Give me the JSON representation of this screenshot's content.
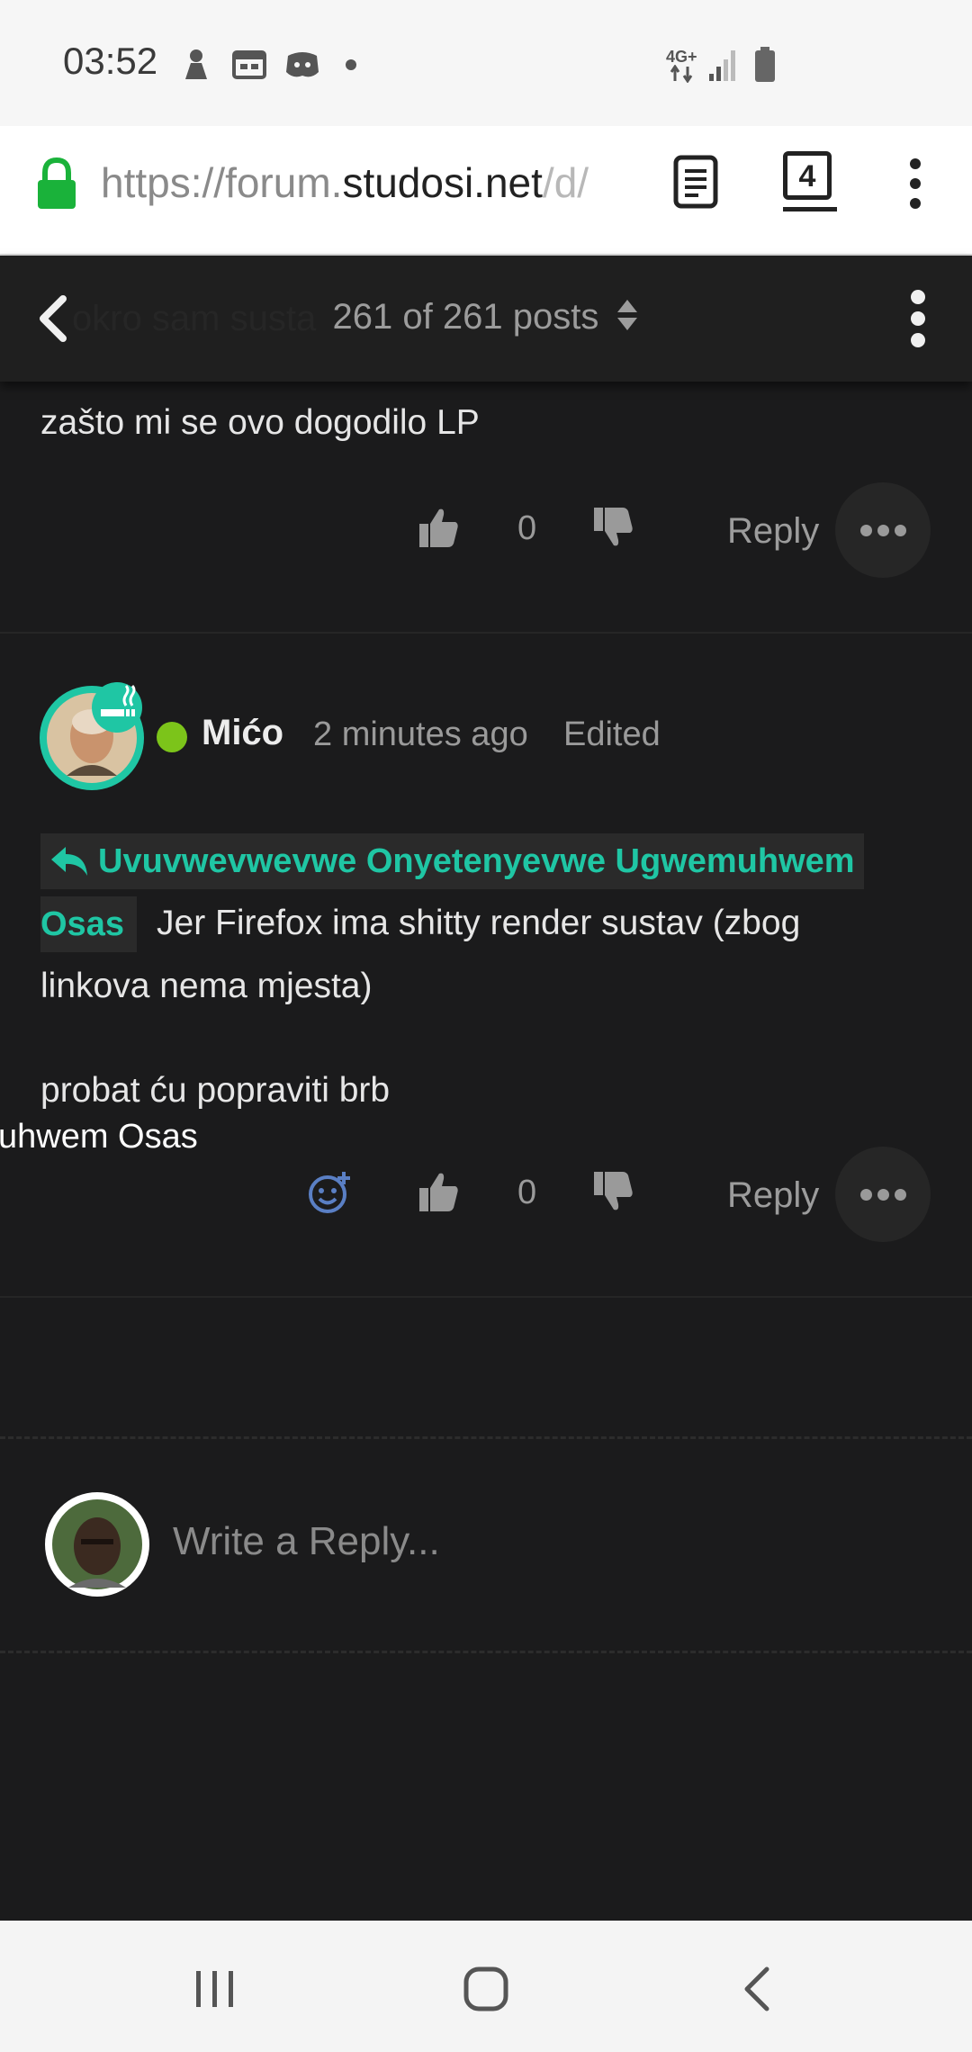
{
  "status_bar": {
    "time": "03:52",
    "network": "4G+"
  },
  "browser": {
    "url_prefix": "https://forum.",
    "url_domain": "studosi.net",
    "url_path": "/d/",
    "tab_count": "4"
  },
  "header": {
    "post_counter": "261 of 261 posts",
    "ghost_text": "okro sam susta"
  },
  "post_prev": {
    "text": "zašto mi se ovo dogodilo LP",
    "vote_count": "0",
    "reply_label": "Reply"
  },
  "post_current": {
    "author": "Mićo",
    "time": "2 minutes ago",
    "edited": "Edited",
    "mention_line1": "Uvuvwevwevwe Onyetenyevwe Ugwemuhwem",
    "mention_line2": "Osas",
    "body_line1": "Jer Firefox ima shitty render sustav (zbog",
    "body_line2": "linkova nema mjesta)",
    "body_line3": "probat ću popraviti brb",
    "overflow_text": "uhwem Osas",
    "vote_count": "0",
    "reply_label": "Reply"
  },
  "composer": {
    "placeholder": "Write a Reply..."
  },
  "colors": {
    "accent": "#1fc6a4",
    "online": "#7cc41a",
    "background": "#1b1b1c"
  }
}
